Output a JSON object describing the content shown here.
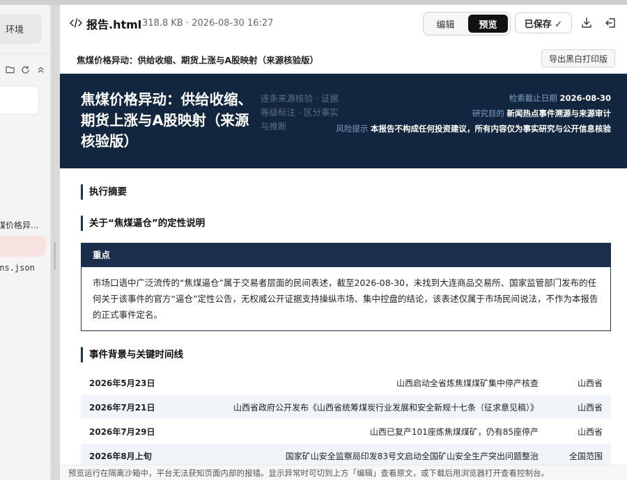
{
  "sidebar": {
    "env_label": "环境",
    "item_report": "煤价格异...",
    "item_json": "ons.json"
  },
  "header": {
    "file_name": "报告.html",
    "file_meta": "318.8 KB · 2026-08-30 16:27",
    "edit_label": "编辑",
    "preview_label": "预览",
    "saved_label": "已保存 ✓"
  },
  "subheader": {
    "doc_title": "焦煤价格异动：供给收缩、期货上涨与A股映射（来源核验版）",
    "export_label": "导出黑白打印版"
  },
  "banner": {
    "title": "焦煤价格异动：供给收缩、期货上涨与A股映射（来源核验版）",
    "tagline": "逐条来源核验 · 证据等级标注 · 区分事实与推断",
    "meta": [
      {
        "key": "检索截止日期",
        "value": "2026-08-30"
      },
      {
        "key": "研究目的",
        "value": "新闻热点事件溯源与来源审计"
      },
      {
        "key": "风险提示",
        "value": "本报告不构成任何投资建议，所有内容仅为事实研究与公开信息核验"
      }
    ]
  },
  "sections": {
    "summary": "执行摘要",
    "definition": "关于“焦煤逼仓”的定性说明",
    "timeline": "事件背景与关键时间线"
  },
  "note": {
    "head": "重点",
    "body": "市场口语中广泛流传的“焦煤逼仓”属于交易者层面的民间表述，截至2026-08-30，未找到大连商品交易所、国家监管部门发布的任何关于该事件的官方“逼仓”定性公告，无权威公开证据支持操纵市场、集中控盘的结论，该表述仅属于市场民间说法，不作为本报告的正式事件定名。"
  },
  "timeline": [
    {
      "date": "2026年5月23日",
      "event": "山西启动全省炼焦煤煤矿集中停产核查",
      "region": "山西省"
    },
    {
      "date": "2026年7月21日",
      "event": "山西省政府公开发布《山西省统筹煤炭行业发展和安全新规十七条（征求意见稿）》",
      "region": "山西省"
    },
    {
      "date": "2026年7月29日",
      "event": "山西已复产101座炼焦煤煤矿，仍有85座停产",
      "region": "山西省"
    },
    {
      "date": "2026年8月上旬",
      "event": "国家矿山安全监察局印发83号文启动全国矿山安全生产突出问题整治",
      "region": "全国范围"
    }
  ],
  "footer": "预览运行在隔离沙箱中，平台无法获知页面内部的报错。显示异常时可切到上方「编辑」查看原文，或下载后用浏览器打开查看控制台。"
}
